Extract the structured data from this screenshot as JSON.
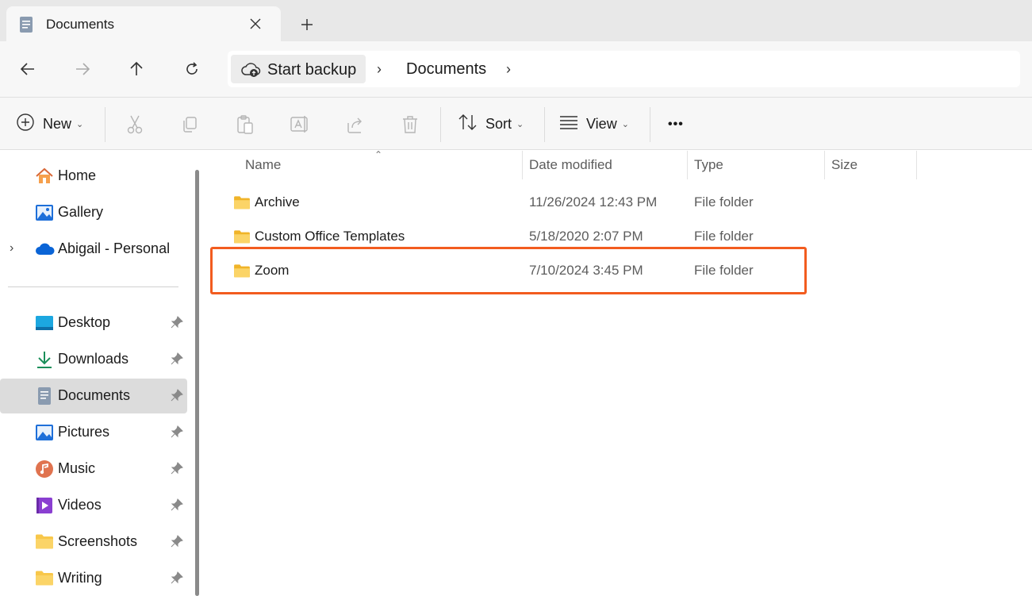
{
  "tab": {
    "title": "Documents",
    "close_icon": "close-icon",
    "new_tab_icon": "plus-icon"
  },
  "nav": {
    "back_icon": "arrow-left-icon",
    "forward_icon": "arrow-right-icon",
    "up_icon": "arrow-up-icon",
    "refresh_icon": "refresh-icon"
  },
  "address": {
    "backup_label": "Start backup",
    "separator": "›",
    "crumb": "Documents",
    "trailing_separator": "›"
  },
  "toolbar": {
    "new_label": "New",
    "sort_label": "Sort",
    "view_label": "View",
    "more_label": "•••",
    "caret": "⌄"
  },
  "sidebar": {
    "items": [
      {
        "label": "Home",
        "icon": "home-icon"
      },
      {
        "label": "Gallery",
        "icon": "gallery-icon"
      },
      {
        "label": "Abigail - Personal",
        "icon": "onedrive-cloud-icon",
        "expand": "›"
      }
    ],
    "pinned": [
      {
        "label": "Desktop",
        "icon": "desktop-icon"
      },
      {
        "label": "Downloads",
        "icon": "download-icon"
      },
      {
        "label": "Documents",
        "icon": "document-icon",
        "selected": true
      },
      {
        "label": "Pictures",
        "icon": "pictures-icon"
      },
      {
        "label": "Music",
        "icon": "music-icon"
      },
      {
        "label": "Videos",
        "icon": "videos-icon"
      },
      {
        "label": "Screenshots",
        "icon": "folder-icon"
      },
      {
        "label": "Writing",
        "icon": "folder-icon"
      }
    ]
  },
  "files": {
    "columns": [
      "Name",
      "Date modified",
      "Type",
      "Size"
    ],
    "sort_indicator": "⌃",
    "rows": [
      {
        "name": "Archive",
        "date": "11/26/2024 12:43 PM",
        "type": "File folder",
        "size": ""
      },
      {
        "name": "Custom Office Templates",
        "date": "5/18/2020 2:07 PM",
        "type": "File folder",
        "size": ""
      },
      {
        "name": "Zoom",
        "date": "7/10/2024 3:45 PM",
        "type": "File folder",
        "size": "",
        "highlighted": true
      }
    ]
  },
  "colors": {
    "highlight": "#f25c1f",
    "accent": "#0067c0",
    "folder": "#f8c74a"
  }
}
